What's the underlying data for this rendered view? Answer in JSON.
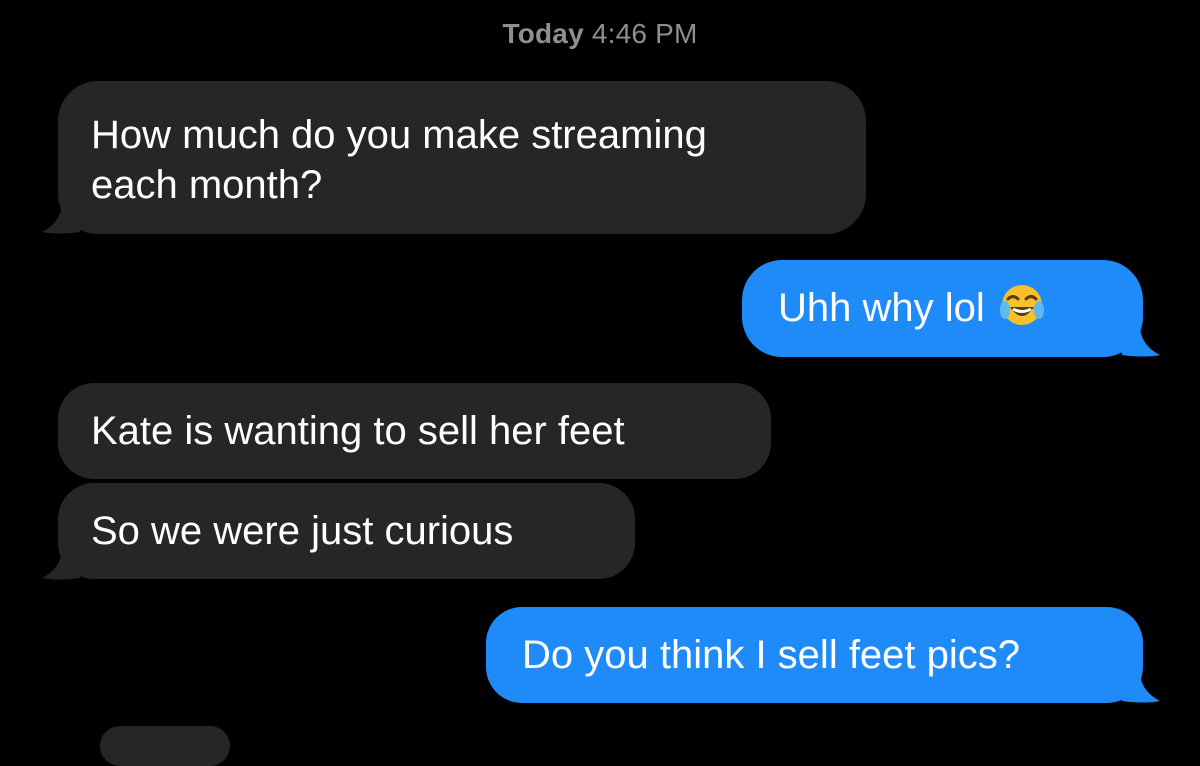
{
  "thread": {
    "timestamp_day": "Today",
    "timestamp_time": "4:46 PM",
    "messages": [
      {
        "direction": "incoming",
        "line1": "How much do you make streaming",
        "line2": "each month?"
      },
      {
        "direction": "outgoing",
        "text": "Uhh why lol",
        "emoji": "face-with-tears-of-joy"
      },
      {
        "direction": "incoming",
        "text": "Kate is wanting to sell her feet"
      },
      {
        "direction": "incoming",
        "text": "So we were just curious"
      },
      {
        "direction": "outgoing",
        "text": "Do you think I sell feet pics?"
      }
    ]
  },
  "colors": {
    "background": "#000000",
    "incoming_bubble": "#262629",
    "outgoing_bubble": "#1e8bf9",
    "timestamp_text": "#8e8e93",
    "message_text": "#ffffff"
  }
}
